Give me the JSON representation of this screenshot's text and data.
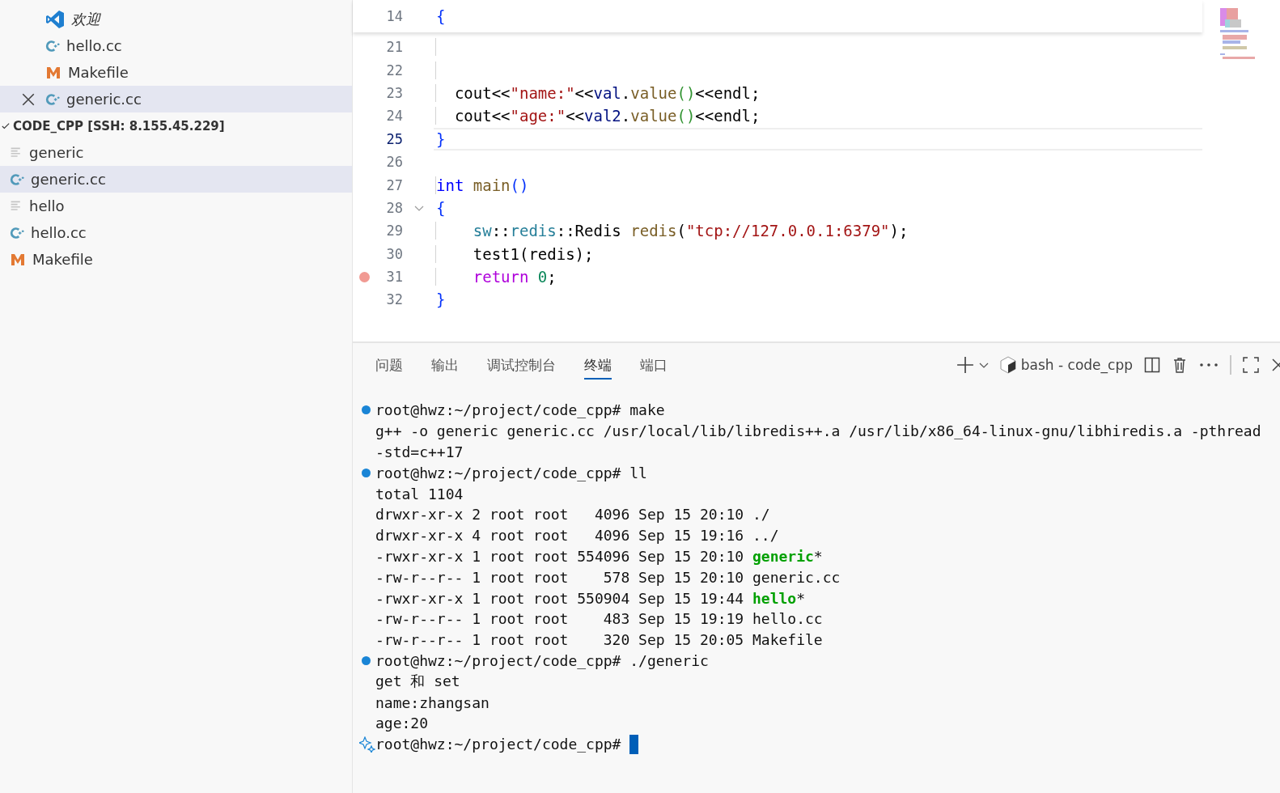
{
  "sidebar": {
    "open_editors": [
      {
        "kind": "vscode",
        "label": "欢迎",
        "preview": true,
        "selected": false,
        "closable": false
      },
      {
        "kind": "cpp",
        "label": "hello.cc",
        "preview": false,
        "selected": false,
        "closable": false
      },
      {
        "kind": "make",
        "label": "Makefile",
        "preview": false,
        "selected": false,
        "closable": false
      },
      {
        "kind": "cpp",
        "label": "generic.cc",
        "preview": false,
        "selected": true,
        "closable": true
      }
    ],
    "folder": {
      "label": "CODE_CPP [SSH: 8.155.45.229]",
      "expanded": true
    },
    "files": [
      {
        "kind": "text",
        "label": "generic",
        "selected": false
      },
      {
        "kind": "cpp",
        "label": "generic.cc",
        "selected": true
      },
      {
        "kind": "text",
        "label": "hello",
        "selected": false
      },
      {
        "kind": "cpp",
        "label": "hello.cc",
        "selected": false
      },
      {
        "kind": "make",
        "label": "Makefile",
        "selected": false
      }
    ]
  },
  "editor": {
    "sticky": {
      "number": "14",
      "tokens": [
        {
          "kind": "bracket1",
          "text": "{"
        }
      ]
    },
    "lines": [
      {
        "number": "21",
        "active": false,
        "breakpoint": false,
        "foldable": false
      },
      {
        "number": "22",
        "active": false,
        "breakpoint": false,
        "foldable": false
      },
      {
        "number": "23",
        "active": false,
        "breakpoint": false,
        "foldable": false,
        "tokens": [
          {
            "kind": "plain",
            "text": "  cout<<"
          },
          {
            "kind": "string",
            "text": "\"name:\""
          },
          {
            "kind": "plain",
            "text": "<<"
          },
          {
            "kind": "variable",
            "text": "val"
          },
          {
            "kind": "plain",
            "text": "."
          },
          {
            "kind": "function",
            "text": "value"
          },
          {
            "kind": "bracket2",
            "text": "()"
          },
          {
            "kind": "plain",
            "text": "<<endl;"
          }
        ]
      },
      {
        "number": "24",
        "active": false,
        "breakpoint": false,
        "foldable": false,
        "tokens": [
          {
            "kind": "plain",
            "text": "  cout<<"
          },
          {
            "kind": "string",
            "text": "\"age:\""
          },
          {
            "kind": "plain",
            "text": "<<"
          },
          {
            "kind": "variable",
            "text": "val2"
          },
          {
            "kind": "plain",
            "text": "."
          },
          {
            "kind": "function",
            "text": "value"
          },
          {
            "kind": "bracket2",
            "text": "()"
          },
          {
            "kind": "plain",
            "text": "<<endl;"
          }
        ]
      },
      {
        "number": "25",
        "active": true,
        "breakpoint": false,
        "foldable": false,
        "tokens": [
          {
            "kind": "bracket1",
            "text": "}"
          }
        ]
      },
      {
        "number": "26",
        "active": false,
        "breakpoint": false,
        "foldable": false
      },
      {
        "number": "27",
        "active": false,
        "breakpoint": false,
        "foldable": false,
        "tokens": [
          {
            "kind": "keyword",
            "text": "int"
          },
          {
            "kind": "function",
            "text": " main"
          },
          {
            "kind": "bracket1",
            "text": "()"
          }
        ]
      },
      {
        "number": "28",
        "active": false,
        "breakpoint": false,
        "foldable": true,
        "tokens": [
          {
            "kind": "bracket1",
            "text": "{"
          }
        ]
      },
      {
        "number": "29",
        "active": false,
        "breakpoint": false,
        "foldable": false,
        "tokens": [
          {
            "kind": "namespace",
            "text": "    sw"
          },
          {
            "kind": "plain",
            "text": "::"
          },
          {
            "kind": "namespace",
            "text": "redis"
          },
          {
            "kind": "plain",
            "text": "::Redis "
          },
          {
            "kind": "function",
            "text": "redis"
          },
          {
            "kind": "plain",
            "text": "("
          },
          {
            "kind": "string",
            "text": "\"tcp://127.0.0.1:6379\""
          },
          {
            "kind": "plain",
            "text": ");"
          }
        ]
      },
      {
        "number": "30",
        "active": false,
        "breakpoint": false,
        "foldable": false,
        "tokens": [
          {
            "kind": "plain",
            "text": "    test1(redis);"
          }
        ]
      },
      {
        "number": "31",
        "active": false,
        "breakpoint": true,
        "foldable": false,
        "tokens": [
          {
            "kind": "control",
            "text": "    return"
          },
          {
            "kind": "number",
            "text": " 0"
          },
          {
            "kind": "plain",
            "text": ";"
          }
        ]
      },
      {
        "number": "32",
        "active": false,
        "breakpoint": false,
        "foldable": false,
        "tokens": [
          {
            "kind": "bracket1",
            "text": "}"
          }
        ]
      }
    ]
  },
  "panel": {
    "tabs": [
      {
        "label": "问题",
        "selected": false
      },
      {
        "label": "输出",
        "selected": false
      },
      {
        "label": "调试控制台",
        "selected": false
      },
      {
        "label": "终端",
        "selected": true
      },
      {
        "label": "端口",
        "selected": false
      }
    ],
    "terminal_name": "bash - code_cpp",
    "terminal": [
      {
        "kind": "command",
        "segments": [
          {
            "kind": "plain",
            "text": "root@hwz:~/project/code_cpp# make"
          }
        ]
      },
      {
        "kind": "output",
        "segments": [
          {
            "kind": "plain",
            "text": "g++ -o generic generic.cc /usr/local/lib/libredis++.a /usr/lib/x86_64-linux-gnu/libhiredis.a -pthread"
          }
        ]
      },
      {
        "kind": "output",
        "segments": [
          {
            "kind": "plain",
            "text": "-std=c++17"
          }
        ]
      },
      {
        "kind": "command",
        "segments": [
          {
            "kind": "plain",
            "text": "root@hwz:~/project/code_cpp# ll"
          }
        ]
      },
      {
        "kind": "output",
        "segments": [
          {
            "kind": "plain",
            "text": "total 1104"
          }
        ]
      },
      {
        "kind": "output",
        "segments": [
          {
            "kind": "plain",
            "text": "drwxr-xr-x 2 root root   4096 Sep 15 20:10 ./"
          }
        ]
      },
      {
        "kind": "output",
        "segments": [
          {
            "kind": "plain",
            "text": "drwxr-xr-x 4 root root   4096 Sep 15 19:16 ../"
          }
        ]
      },
      {
        "kind": "output",
        "segments": [
          {
            "kind": "plain",
            "text": "-rwxr-xr-x 1 root root 554096 Sep 15 20:10 "
          },
          {
            "kind": "exec",
            "text": "generic"
          },
          {
            "kind": "plain",
            "text": "*"
          }
        ]
      },
      {
        "kind": "output",
        "segments": [
          {
            "kind": "plain",
            "text": "-rw-r--r-- 1 root root    578 Sep 15 20:10 generic.cc"
          }
        ]
      },
      {
        "kind": "output",
        "segments": [
          {
            "kind": "plain",
            "text": "-rwxr-xr-x 1 root root 550904 Sep 15 19:44 "
          },
          {
            "kind": "exec",
            "text": "hello"
          },
          {
            "kind": "plain",
            "text": "*"
          }
        ]
      },
      {
        "kind": "output",
        "segments": [
          {
            "kind": "plain",
            "text": "-rw-r--r-- 1 root root    483 Sep 15 19:19 hello.cc"
          }
        ]
      },
      {
        "kind": "output",
        "segments": [
          {
            "kind": "plain",
            "text": "-rw-r--r-- 1 root root    320 Sep 15 20:05 Makefile"
          }
        ]
      },
      {
        "kind": "command",
        "segments": [
          {
            "kind": "plain",
            "text": "root@hwz:~/project/code_cpp# ./generic"
          }
        ]
      },
      {
        "kind": "output",
        "segments": [
          {
            "kind": "plain",
            "text": "get 和 set"
          }
        ]
      },
      {
        "kind": "output",
        "segments": [
          {
            "kind": "plain",
            "text": "name:zhangsan"
          }
        ]
      },
      {
        "kind": "output",
        "segments": [
          {
            "kind": "plain",
            "text": "age:20"
          }
        ]
      },
      {
        "kind": "current",
        "segments": [
          {
            "kind": "plain",
            "text": "root@hwz:~/project/code_cpp# "
          }
        ]
      }
    ]
  }
}
